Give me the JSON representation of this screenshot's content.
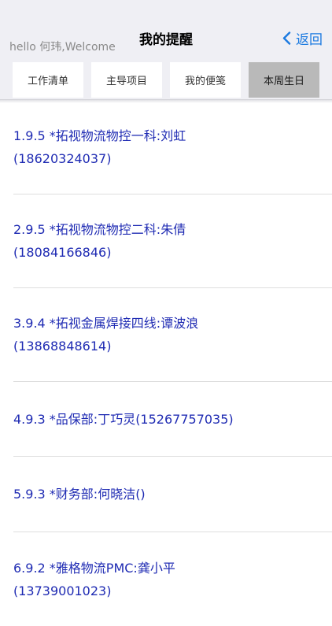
{
  "header": {
    "greeting": "hello 何玮,Welcome",
    "title": "我的提醒",
    "back_label": "返回"
  },
  "tabs": [
    {
      "label": "工作清单",
      "active": false
    },
    {
      "label": "主导项目",
      "active": false
    },
    {
      "label": "我的便笺",
      "active": false
    },
    {
      "label": "本周生日",
      "active": true
    }
  ],
  "birthdays": [
    {
      "line1": "1.9.5 *拓视物流物控一科:刘虹",
      "line2": "(18620324037)"
    },
    {
      "line1": "2.9.5 *拓视物流物控二科:朱倩",
      "line2": "(18084166846)"
    },
    {
      "line1": "3.9.4 *拓视金属焊接四线:谭波浪",
      "line2": "(13868848614)"
    },
    {
      "line1": "4.9.3 *品保部:丁巧灵(15267757035)",
      "line2": ""
    },
    {
      "line1": "5.9.3 *财务部:何晓洁()",
      "line2": ""
    },
    {
      "line1": "6.9.2 *雅格物流PMC:龚小平",
      "line2": "(13739001023)"
    }
  ],
  "colors": {
    "accent": "#1b7ae0",
    "item_text": "#1f2bb3",
    "active_tab": "#b9b9b9"
  }
}
